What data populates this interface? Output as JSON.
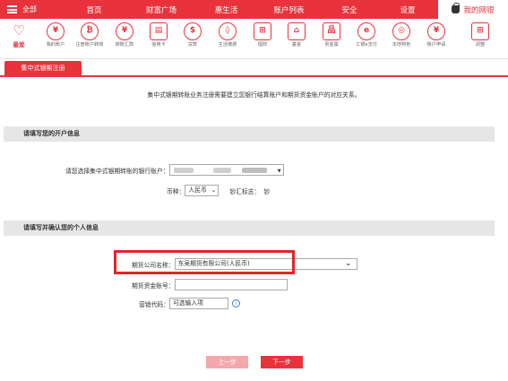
{
  "topnav": {
    "all_label": "全部",
    "items": [
      "首页",
      "财富广场",
      "惠生活",
      "账户列表",
      "安全",
      "设置"
    ],
    "my_bank": "我的网银"
  },
  "iconbar": {
    "items": [
      {
        "label": "最爱",
        "icon": "heart-icon",
        "glyph": "♡"
      },
      {
        "label": "我的账户",
        "icon": "yen-icon",
        "glyph": "¥"
      },
      {
        "label": "注册账户转账",
        "icon": "transfer-icon",
        "glyph": "₿"
      },
      {
        "label": "转账汇款",
        "icon": "remit-icon",
        "glyph": "¥"
      },
      {
        "label": "信用卡",
        "icon": "credit-card-icon",
        "glyph": "▤"
      },
      {
        "label": "贷款",
        "icon": "loan-icon",
        "glyph": "$"
      },
      {
        "label": "生活缴费",
        "icon": "drop-icon",
        "glyph": "◊"
      },
      {
        "label": "理财",
        "icon": "finance-icon",
        "glyph": "⊞"
      },
      {
        "label": "基金",
        "icon": "fund-icon",
        "glyph": "⌂"
      },
      {
        "label": "贵金属",
        "icon": "metal-icon",
        "glyph": "品"
      },
      {
        "label": "工银e支付",
        "icon": "epay-icon",
        "glyph": "e"
      },
      {
        "label": "本地特色",
        "icon": "local-icon",
        "glyph": "◎"
      },
      {
        "label": "账户申请",
        "icon": "apply-icon",
        "glyph": "¥"
      },
      {
        "label": "调整",
        "icon": "adjust-icon",
        "glyph": "⊞"
      }
    ]
  },
  "tab": {
    "label": "集中式银期注册"
  },
  "intro": "集中式银期转账业务注册需要建立您银行结算账户和期货资金账户的对应关系。",
  "section1": {
    "title": "请填写您的开户信息",
    "bank_account_label": "请您选择集中式银期转账的银行账户：",
    "currency_label": "币种：",
    "currency_value": "人民币",
    "cash_flag_label": "钞汇标志：",
    "cash_flag_value": "钞"
  },
  "section2": {
    "title": "请填写并确认您的个人信息",
    "company_label": "期货公司名称：",
    "company_value": "东吴期货有限公司(人民币)",
    "fund_account_label": "期货资金账号：",
    "fund_account_value": "",
    "marketing_label": "营销代码：",
    "marketing_placeholder": "可选输入项"
  },
  "buttons": {
    "prev": "上一步",
    "next": "下一步"
  },
  "colors": {
    "brand": "#e8333c",
    "section_bg": "#e6e6e6",
    "highlight": "#e0242b"
  }
}
